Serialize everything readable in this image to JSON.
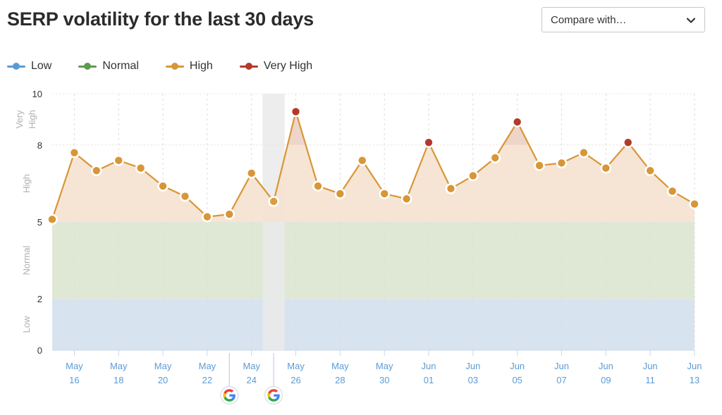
{
  "header": {
    "title": "SERP volatility for the last 30 days",
    "compare_label": "Compare with…",
    "chevron_icon": "chevron-down-icon"
  },
  "legend": {
    "position": "top-left",
    "items": [
      {
        "label": "Low",
        "color": "#5b9bd5"
      },
      {
        "label": "Normal",
        "color": "#5d9b52"
      },
      {
        "label": "High",
        "color": "#d89637"
      },
      {
        "label": "Very High",
        "color": "#b33a2b"
      }
    ]
  },
  "annotations": {
    "google_updates": [
      {
        "icon": "google-logo-icon",
        "date": "May 23"
      },
      {
        "icon": "google-logo-icon",
        "date": "May 25"
      }
    ],
    "highlight_band": {
      "start_date": "May 25",
      "end_date": "May 25",
      "color": "#eaeaea"
    }
  },
  "chart_data": {
    "type": "area",
    "title": "SERP volatility for the last 30 days",
    "xlabel": "",
    "ylabel": "",
    "ylim": [
      0,
      10
    ],
    "yticks": [
      0,
      2,
      5,
      8,
      10
    ],
    "grid": true,
    "bands": [
      {
        "name": "Low",
        "range": [
          0,
          2
        ],
        "color": "#d8e3f0",
        "label": "Low"
      },
      {
        "name": "Normal",
        "range": [
          2,
          5
        ],
        "color": "#dfe8d4",
        "label": "Normal"
      },
      {
        "name": "High",
        "range": [
          5,
          8
        ],
        "color": "#f6e4d2",
        "label": "High"
      },
      {
        "name": "Very High",
        "range": [
          8,
          10
        ],
        "color": "#f0dcd6",
        "label": "Very High"
      }
    ],
    "x": [
      "May 15",
      "May 16",
      "May 17",
      "May 18",
      "May 19",
      "May 20",
      "May 21",
      "May 22",
      "May 23",
      "May 24",
      "May 25",
      "May 26",
      "May 27",
      "May 28",
      "May 29",
      "May 30",
      "May 31",
      "Jun 01",
      "Jun 02",
      "Jun 03",
      "Jun 04",
      "Jun 05",
      "Jun 06",
      "Jun 07",
      "Jun 08",
      "Jun 09",
      "Jun 10",
      "Jun 11",
      "Jun 12",
      "Jun 13"
    ],
    "xticks": [
      "May 16",
      "May 18",
      "May 20",
      "May 22",
      "May 24",
      "May 26",
      "May 28",
      "May 30",
      "Jun 01",
      "Jun 03",
      "Jun 05",
      "Jun 07",
      "Jun 09",
      "Jun 11",
      "Jun 13"
    ],
    "series": [
      {
        "name": "SERP volatility",
        "values": [
          5.1,
          7.7,
          7.0,
          7.4,
          7.1,
          6.4,
          6.0,
          5.2,
          5.3,
          6.9,
          5.8,
          9.3,
          6.4,
          6.1,
          7.4,
          6.1,
          5.9,
          8.1,
          6.3,
          6.8,
          7.5,
          8.9,
          7.2,
          7.3,
          7.7,
          7.1,
          8.1,
          7.0,
          6.2,
          5.7
        ],
        "point_levels": [
          "High",
          "High",
          "High",
          "High",
          "High",
          "High",
          "High",
          "High",
          "High",
          "High",
          "High",
          "Very High",
          "High",
          "High",
          "High",
          "High",
          "High",
          "Very High",
          "High",
          "High",
          "High",
          "Very High",
          "High",
          "High",
          "High",
          "High",
          "Very High",
          "High",
          "High",
          "High"
        ],
        "estimated_points": [
          "May 25"
        ],
        "line_color": "#d89637",
        "fill_color": "#f6e4d2"
      }
    ]
  }
}
